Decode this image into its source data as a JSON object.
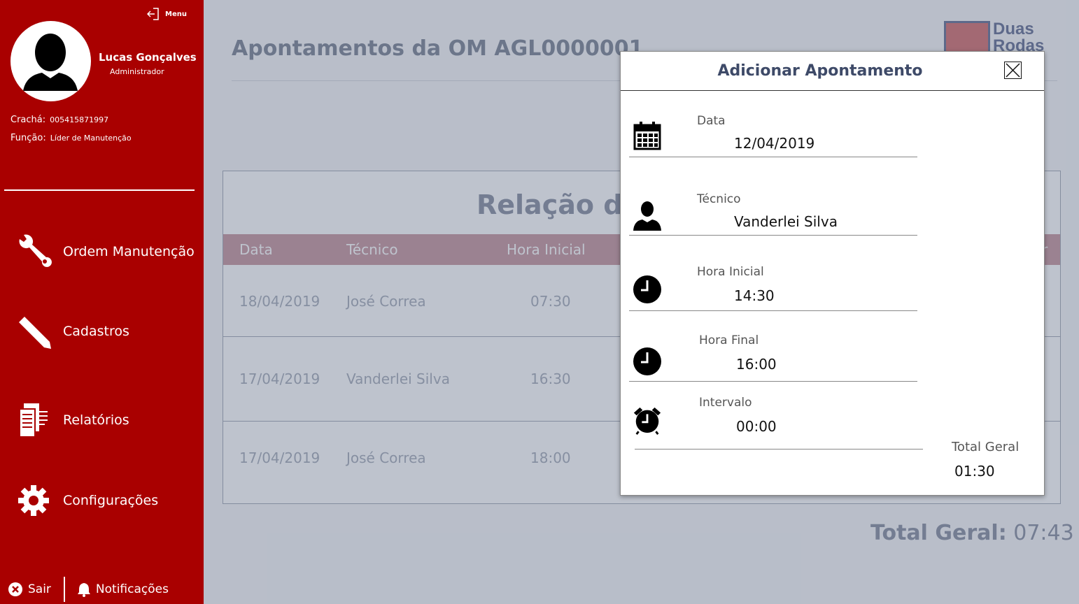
{
  "sidebar": {
    "menu_label": "Menu",
    "user": {
      "name": "Lucas Gonçalves",
      "role": "Administrador"
    },
    "cracha": {
      "label": "Crachá:",
      "value": "005415871997"
    },
    "funcao": {
      "label": "Função:",
      "value": "Líder de Manutenção"
    },
    "nav": [
      {
        "label": "Ordem Manutenção",
        "icon": "wrench-icon"
      },
      {
        "label": "Cadastros",
        "icon": "pencil-icon"
      },
      {
        "label": "Relatórios",
        "icon": "reports-icon"
      },
      {
        "label": "Configurações",
        "icon": "gear-icon"
      }
    ],
    "sair_label": "Sair",
    "notificacoes_label": "Notificações"
  },
  "main": {
    "title": "Apontamentos da OM AGL0000001",
    "logo_text_1": "Duas",
    "logo_text_2": "Rodas",
    "table_title": "Relação de",
    "columns": [
      "Data",
      "Técnico",
      "Hora Inicial",
      "r"
    ],
    "rows": [
      {
        "data": "18/04/2019",
        "tecnico": "José Correa",
        "hora_inicial": "07:30"
      },
      {
        "data": "17/04/2019",
        "tecnico": "Vanderlei Silva",
        "hora_inicial": "16:30"
      },
      {
        "data": "17/04/2019",
        "tecnico": "José Correa",
        "hora_inicial": "18:00"
      }
    ],
    "total_label": "Total Geral:",
    "total_value": "07:43"
  },
  "modal": {
    "title": "Adicionar Apontamento",
    "fields": [
      {
        "label": "Data",
        "value": "12/04/2019",
        "icon": "calendar-icon"
      },
      {
        "label": "Técnico",
        "value": "Vanderlei Silva",
        "icon": "person-icon"
      },
      {
        "label": "Hora Inicial",
        "value": "14:30",
        "icon": "clock-icon"
      },
      {
        "label": "Hora Final",
        "value": "16:00",
        "icon": "clock-icon"
      },
      {
        "label": "Intervalo",
        "value": "00:00",
        "icon": "alarm-clock-icon"
      }
    ],
    "total_label": "Total Geral",
    "total_value": "01:30"
  },
  "colors": {
    "sidebar_bg": "#a90000",
    "table_header_bg": "#b97c86",
    "title_text": "#5a6478"
  }
}
